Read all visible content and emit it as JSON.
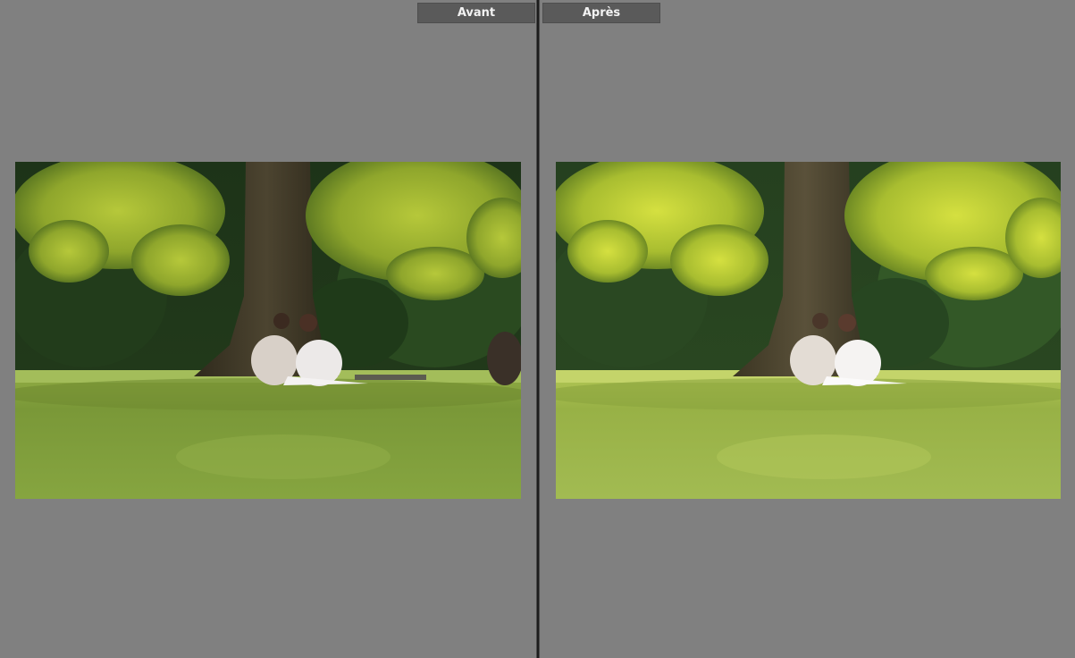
{
  "compare": {
    "before_label": "Avant",
    "after_label": "Après"
  },
  "colors": {
    "background": "#808080",
    "label_bg": "#5a5a5a",
    "label_text": "#f2f2f2",
    "divider": "#1c1c1c"
  }
}
